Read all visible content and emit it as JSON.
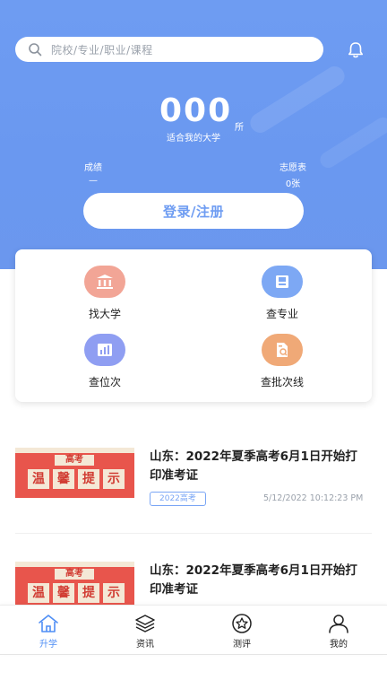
{
  "search": {
    "placeholder": "院校/专业/职业/课程"
  },
  "stats": {
    "count": "000",
    "unit": "所",
    "label": "适合我的大学",
    "score_label": "成绩",
    "score_value": "—",
    "wish_label": "志愿表",
    "wish_value": "0张"
  },
  "login_button": "登录/注册",
  "grid": [
    {
      "label": "找大学",
      "icon": "university-icon",
      "color": "#f2a596"
    },
    {
      "label": "查专业",
      "icon": "book-icon",
      "color": "#7da8f4"
    },
    {
      "label": "查位次",
      "icon": "bar-chart-icon",
      "color": "#8f9ef2"
    },
    {
      "label": "查批次线",
      "icon": "document-search-icon",
      "color": "#f0a977"
    }
  ],
  "news": [
    {
      "title": "山东：2022年夏季高考6月1日开始打印准考证",
      "tag": "2022高考",
      "time": "5/12/2022 10:12:23 PM",
      "thumb_top": "高考",
      "thumb_chars": [
        "温",
        "馨",
        "提",
        "示"
      ]
    },
    {
      "title": "山东：2022年夏季高考6月1日开始打印准考证",
      "thumb_top": "高考",
      "thumb_chars": [
        "温",
        "馨",
        "提",
        "示"
      ]
    }
  ],
  "tabs": [
    {
      "label": "升学",
      "icon": "home-icon",
      "active": true
    },
    {
      "label": "资讯",
      "icon": "layers-icon",
      "active": false
    },
    {
      "label": "测评",
      "icon": "star-icon",
      "active": false
    },
    {
      "label": "我的",
      "icon": "user-icon",
      "active": false
    }
  ],
  "colors": {
    "primary": "#6e9cf2",
    "active_tab": "#4f8ef5",
    "thumb_red": "#e8554c"
  }
}
